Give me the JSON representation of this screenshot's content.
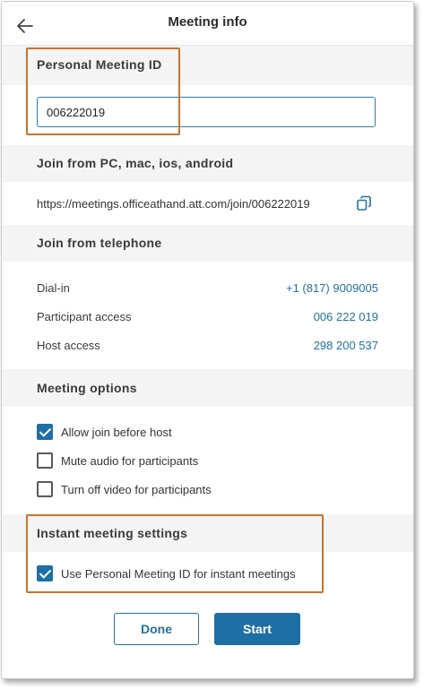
{
  "header": {
    "title": "Meeting info",
    "back_icon": "arrow-left-icon"
  },
  "personal_meeting_id": {
    "heading": "Personal Meeting ID",
    "value": "006222019"
  },
  "join_pc": {
    "heading": "Join from PC, mac, ios, android",
    "url": "https://meetings.officeathand.att.com/join/006222019",
    "copy_icon": "copy-icon"
  },
  "join_telephone": {
    "heading": "Join from telephone",
    "rows": [
      {
        "label": "Dial-in",
        "value": "+1 (817) 9009005"
      },
      {
        "label": "Participant access",
        "value": "006 222 019"
      },
      {
        "label": "Host access",
        "value": "298 200 537"
      }
    ]
  },
  "meeting_options": {
    "heading": "Meeting options",
    "options": [
      {
        "label": "Allow join before host",
        "checked": true
      },
      {
        "label": "Mute audio for participants",
        "checked": false
      },
      {
        "label": "Turn off video for participants",
        "checked": false
      }
    ]
  },
  "instant_meeting": {
    "heading": "Instant meeting settings",
    "option": {
      "label": "Use Personal Meeting ID for instant meetings",
      "checked": true
    }
  },
  "actions": {
    "done_label": "Done",
    "start_label": "Start"
  },
  "colors": {
    "accent": "#1e6fa5",
    "link": "#2271a4",
    "highlight": "#c8742a",
    "section_bg": "#f4f4f4"
  }
}
